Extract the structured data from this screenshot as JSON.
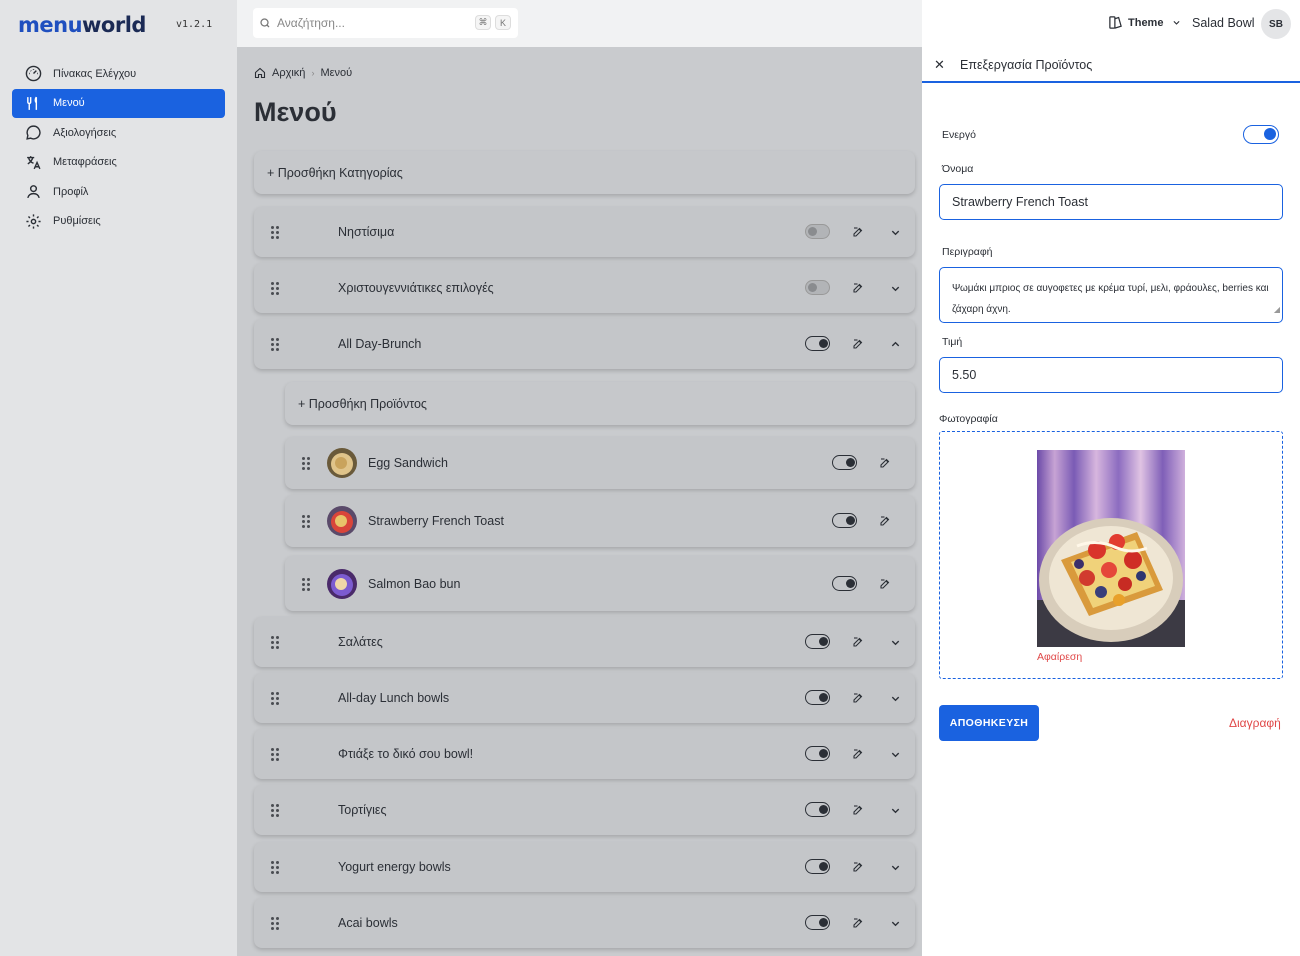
{
  "app": {
    "logo_text_a": "menu",
    "logo_text_b": "world",
    "version": "v1.2.1"
  },
  "sidebar": {
    "items": [
      {
        "label": "Πίνακας Ελέγχου",
        "icon": "dashboard-icon",
        "active": false
      },
      {
        "label": "Μενού",
        "icon": "cutlery-icon",
        "active": true
      },
      {
        "label": "Αξιολογήσεις",
        "icon": "chat-bubble-icon",
        "active": false
      },
      {
        "label": "Μεταφράσεις",
        "icon": "translate-icon",
        "active": false
      },
      {
        "label": "Προφίλ",
        "icon": "user-icon",
        "active": false
      },
      {
        "label": "Ρυθμίσεις",
        "icon": "gear-icon",
        "active": false
      }
    ]
  },
  "search": {
    "placeholder": "Αναζήτηση...",
    "shortcut_key1": "⌘",
    "shortcut_key2": "K"
  },
  "breadcrumb": {
    "home": "Αρχική",
    "current": "Μενού"
  },
  "page": {
    "title": "Μενού",
    "add_category": "+ Προσθήκη Κατηγορίας",
    "add_product": "+ Προσθήκη Προϊόντος"
  },
  "categories": [
    {
      "name": "Νηστίσιμα",
      "enabled": false,
      "expanded": false
    },
    {
      "name": "Χριστουγεννιάτικες επιλογές",
      "enabled": false,
      "expanded": false
    },
    {
      "name": "All Day-Brunch",
      "enabled": true,
      "expanded": true
    },
    {
      "name": "Σαλάτες",
      "enabled": true,
      "expanded": false
    },
    {
      "name": "All-day Lunch bowls",
      "enabled": true,
      "expanded": false
    },
    {
      "name": "Φτιάξε το δικό σου bowl!",
      "enabled": true,
      "expanded": false
    },
    {
      "name": "Τορτίγιες",
      "enabled": true,
      "expanded": false
    },
    {
      "name": "Yogurt energy bowls",
      "enabled": true,
      "expanded": false
    },
    {
      "name": "Acai bowls",
      "enabled": true,
      "expanded": false
    }
  ],
  "products": [
    {
      "name": "Egg Sandwich",
      "enabled": true
    },
    {
      "name": "Strawberry French Toast",
      "enabled": true
    },
    {
      "name": "Salmon Bao bun",
      "enabled": true
    }
  ],
  "header": {
    "theme_label": "Theme",
    "restaurant": "Salad Bowl",
    "avatar_initials": "SB"
  },
  "edit_panel": {
    "title": "Επεξεργασία Προϊόντος",
    "active_label": "Ενεργό",
    "active": true,
    "name_label": "Όνομα",
    "name_value": "Strawberry French Toast",
    "description_label": "Περιγραφή",
    "description_value": "Ψωμάκι μπριος σε αυγοφετες με κρέμα τυρί, μελι, φράουλες, berries και ζάχαρη άχνη.",
    "price_label": "Τιμή",
    "price_value": "5.50",
    "photo_label": "Φωτογραφία",
    "remove_label": "Αφαίρεση",
    "save_label": "ΑΠΟΘΗΚΕΥΣΗ",
    "delete_label": "Διαγραφή"
  },
  "colors": {
    "accent": "#1a62e0",
    "danger": "#e04848",
    "sidebar_bg": "#e3e4e6",
    "overlay_bg": "#c9cbce"
  }
}
